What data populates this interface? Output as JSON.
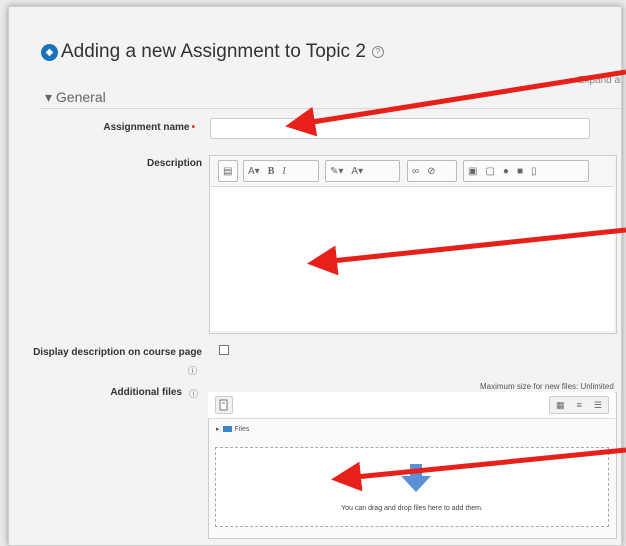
{
  "page": {
    "title": "Adding a new Assignment to Topic 2",
    "expand_all": "Expand all",
    "section": "General"
  },
  "form": {
    "assignment_name_label": "Assignment name",
    "required_mark": "•",
    "assignment_name_value": "",
    "description_label": "Description",
    "display_description_label": "Display description on course page",
    "additional_files_label": "Additional files"
  },
  "editor_toolbar": {
    "buttons": [
      "collapse",
      "paragraph-styles",
      "bold",
      "italic",
      "text-color",
      "font-color",
      "link",
      "unlink",
      "image",
      "media",
      "record-audio",
      "record-video",
      "manage-files"
    ],
    "bold": "B",
    "italic": "I",
    "font_a": "A"
  },
  "filepicker": {
    "max_size": "Maximum size for new files: Unlimited",
    "files_label": "Files",
    "drop_message": "You can drag and drop files here to add them."
  },
  "annotations": {
    "arrow_color": "#e8201a"
  }
}
